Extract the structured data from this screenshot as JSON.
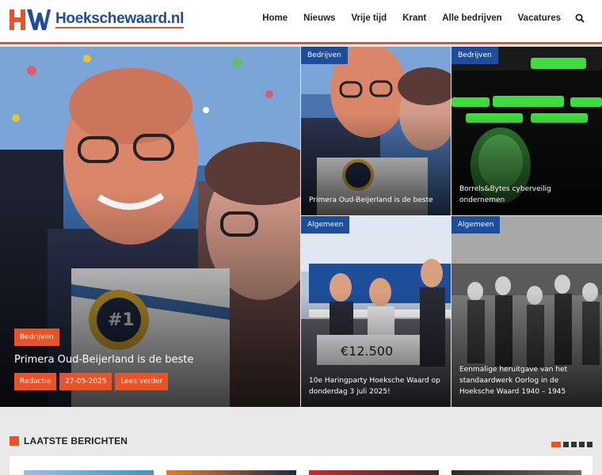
{
  "site": {
    "logo_text": "Hoekschewaard.nl"
  },
  "nav": {
    "items": [
      "Home",
      "Nieuws",
      "Vrije tijd",
      "Krant",
      "Alle bedrijven",
      "Vacatures"
    ]
  },
  "hero": {
    "main": {
      "category": "Bedrijven",
      "title": "Primera Oud-Beijerland is de beste",
      "author": "Redactie",
      "date": "27-05-2025",
      "read_more": "Lees verder"
    },
    "tiles": [
      {
        "category": "Bedrijven",
        "title": "Primera Oud-Beijerland is de beste"
      },
      {
        "category": "Bedrijven",
        "title": "Borrels&Bytes cyberveilig ondernemen"
      },
      {
        "category": "Algemeen",
        "title": "10e Haringparty Hoeksche Waard op donderdag 3 juli 2025!"
      },
      {
        "category": "Algemeen",
        "title": "Eenmalige heruitgave van het standaardwerk  Oorlog in de Hoeksche Waard 1940 – 1945"
      }
    ]
  },
  "latest": {
    "title": "LAATSTE BERICHTEN"
  },
  "colors": {
    "accent": "#e8542a",
    "brand_blue": "#1e4e9a"
  }
}
